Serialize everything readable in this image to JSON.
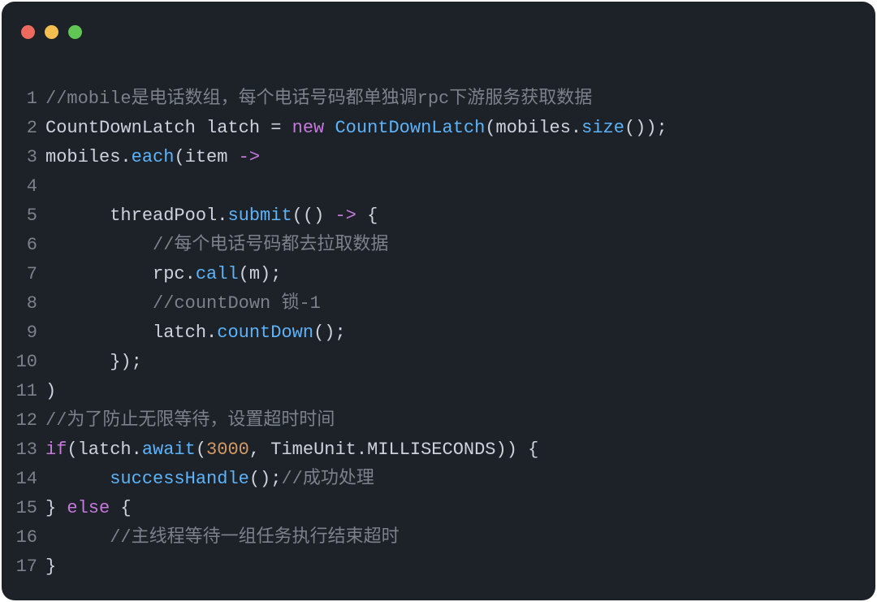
{
  "window": {
    "traffic_lights": [
      "close",
      "minimize",
      "zoom"
    ]
  },
  "gutter": {
    "1": "1",
    "2": "2",
    "3": "3",
    "4": "4",
    "5": "5",
    "6": "6",
    "7": "7",
    "8": "8",
    "9": "9",
    "10": "10",
    "11": "11",
    "12": "12",
    "13": "13",
    "14": "14",
    "15": "15",
    "16": "16",
    "17": "17"
  },
  "code": {
    "l1": {
      "comment": "//mobile是电话数组，每个电话号码都单独调rpc下游服务获取数据"
    },
    "l2": {
      "a": "CountDownLatch latch ",
      "eq": "=",
      "new_kw": " new",
      "ctor": " CountDownLatch",
      "paren1": "(mobiles.",
      "size": "size",
      "paren2": "());"
    },
    "l3": {
      "a": "mobiles.",
      "each": "each",
      "b": "(item ",
      "arrow": "->"
    },
    "l4": {
      "blank": ""
    },
    "l5": {
      "indent": "      ",
      "a": "threadPool.",
      "submit": "submit",
      "b": "(() ",
      "arrow": "->",
      "brace": " {"
    },
    "l6": {
      "indent": "          ",
      "comment": "//每个电话号码都去拉取数据"
    },
    "l7": {
      "indent": "          ",
      "a": "rpc.",
      "call": "call",
      "b": "(m);"
    },
    "l8": {
      "indent": "          ",
      "comment": "//countDown 锁-1"
    },
    "l9": {
      "indent": "          ",
      "a": "latch.",
      "countDown": "countDown",
      "b": "();"
    },
    "l10": {
      "indent": "      ",
      "a": "});"
    },
    "l11": {
      "a": ")"
    },
    "l12": {
      "comment": "//为了防止无限等待，设置超时时间"
    },
    "l13": {
      "if_kw": "if",
      "a": "(latch.",
      "await": "await",
      "b": "(",
      "num": "3000",
      "c": ", TimeUnit.MILLISECONDS)) {"
    },
    "l14": {
      "indent": "      ",
      "fn": "successHandle",
      "a": "();",
      "comment": "//成功处理"
    },
    "l15": {
      "a": "} ",
      "else_kw": "else",
      "b": " {"
    },
    "l16": {
      "indent": "      ",
      "comment": "//主线程等待一组任务执行结束超时"
    },
    "l17": {
      "a": "}"
    }
  }
}
